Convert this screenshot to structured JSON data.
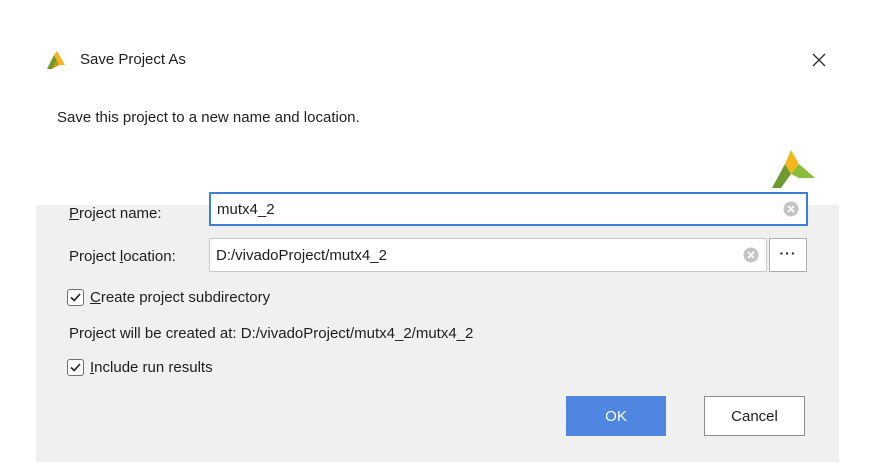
{
  "window": {
    "title": "Save Project As"
  },
  "header": {
    "description": "Save this project to a new name and location."
  },
  "form": {
    "project_name": {
      "label_mnemonic": "P",
      "label_rest": "roject name:",
      "value": "mutx4_2"
    },
    "project_location": {
      "label_pre": "Project ",
      "label_mnemonic": "l",
      "label_rest": "ocation:",
      "value": "D:/vivadoProject/mutx4_2",
      "browse_label": "···"
    },
    "create_subdir": {
      "checked": true,
      "label_mnemonic": "C",
      "label_rest": "reate project subdirectory"
    },
    "created_at": "Project will be created at: D:/vivadoProject/mutx4_2/mutx4_2",
    "include_runs": {
      "checked": true,
      "label_mnemonic": "I",
      "label_rest": "nclude run results"
    }
  },
  "buttons": {
    "ok": "OK",
    "cancel": "Cancel"
  },
  "colors": {
    "accent": "#4e86e1",
    "focus_border": "#3d7fd6",
    "logo_yellow": "#f4b51d",
    "logo_green": "#6c9a2e"
  }
}
